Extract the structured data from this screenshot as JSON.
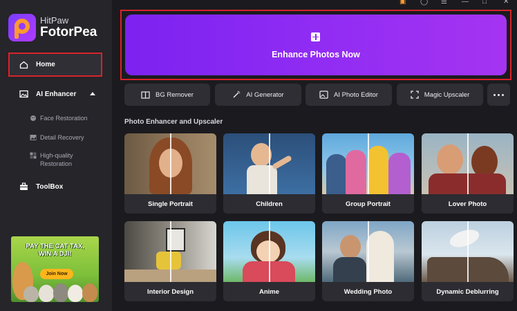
{
  "app": {
    "brand_sub": "HitPaw",
    "brand_title": "FotorPea"
  },
  "sidebar": {
    "home": "Home",
    "ai_enhancer": "AI Enhancer",
    "sub_items": [
      "Face Restoration",
      "Detail Recovery",
      "High-quality",
      "Restoration"
    ],
    "toolbox": "ToolBox",
    "promo": {
      "line1": "PAY THE CAT TAX,",
      "line2": "WIN A DJI!",
      "button": "Join Now"
    }
  },
  "banner": {
    "label": "Enhance Photos Now"
  },
  "tools": [
    "BG Remover",
    "AI Generator",
    "AI Photo Editor",
    "Magic Upscaler"
  ],
  "section": {
    "title": "Photo Enhancer and Upscaler"
  },
  "cards": [
    "Single Portrait",
    "Children",
    "Group Portrait",
    "Lover Photo",
    "Interior Design",
    "Anime",
    "Wedding Photo",
    "Dynamic Deblurring"
  ],
  "colors": {
    "accent": "#8e2bf3",
    "highlight_border": "#d8232a",
    "promo_button": "#ffb51b"
  }
}
